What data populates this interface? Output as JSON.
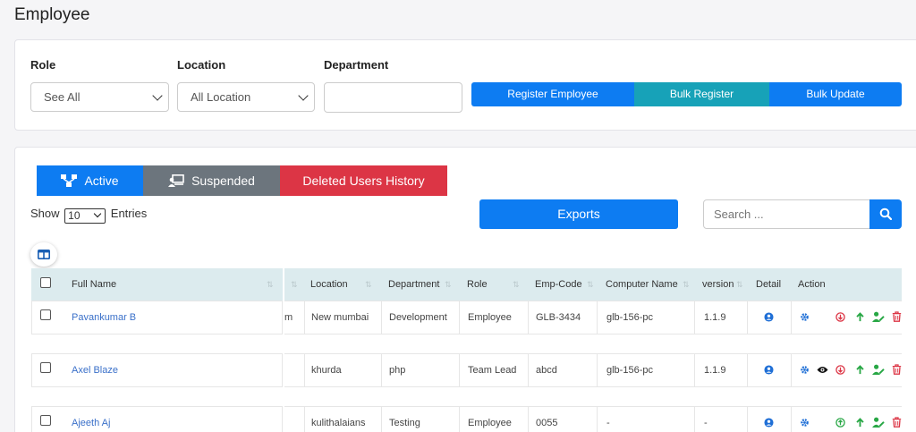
{
  "page": {
    "title": "Employee"
  },
  "filters": {
    "role_label": "Role",
    "role_value": "See All",
    "location_label": "Location",
    "location_value": "All Location",
    "department_label": "Department",
    "department_value": ""
  },
  "actions": {
    "register": "Register Employee",
    "bulk_register": "Bulk Register",
    "bulk_update": "Bulk Update"
  },
  "tabs": {
    "active": "Active",
    "suspended": "Suspended",
    "deleted": "Deleted Users History"
  },
  "listing": {
    "show_label": "Show",
    "page_length": "10",
    "entries_label": "Entries",
    "exports": "Exports",
    "search_placeholder": "Search ..."
  },
  "table": {
    "columns": {
      "full_name": "Full Name",
      "location": "Location",
      "department": "Department",
      "role": "Role",
      "emp_code": "Emp-Code",
      "computer_name": "Computer Name",
      "version": "version",
      "detail": "Detail",
      "action": "Action"
    },
    "rows": [
      {
        "full_name": "Pavankumar B",
        "partial": "m",
        "location": "New mumbai",
        "department": "Development",
        "role": "Employee",
        "emp_code": "GLB-3434",
        "computer_name": "glb-156-pc",
        "version": "1.1.9"
      },
      {
        "full_name": "Axel Blaze",
        "partial": "",
        "location": "khurda",
        "department": "php",
        "role": "Team Lead",
        "emp_code": "abcd",
        "computer_name": "glb-156-pc",
        "version": "1.1.9"
      },
      {
        "full_name": "Ajeeth Aj",
        "partial": "",
        "location": "kulithalaians",
        "department": "Testing",
        "role": "Employee",
        "emp_code": "0055",
        "computer_name": "-",
        "version": "-"
      }
    ]
  },
  "colors": {
    "primary": "#0d7cf2",
    "teal": "#17a2b8",
    "gray": "#6c757d",
    "danger": "#dc3545",
    "header_bg": "#dcebee",
    "link": "#3a70c9"
  }
}
